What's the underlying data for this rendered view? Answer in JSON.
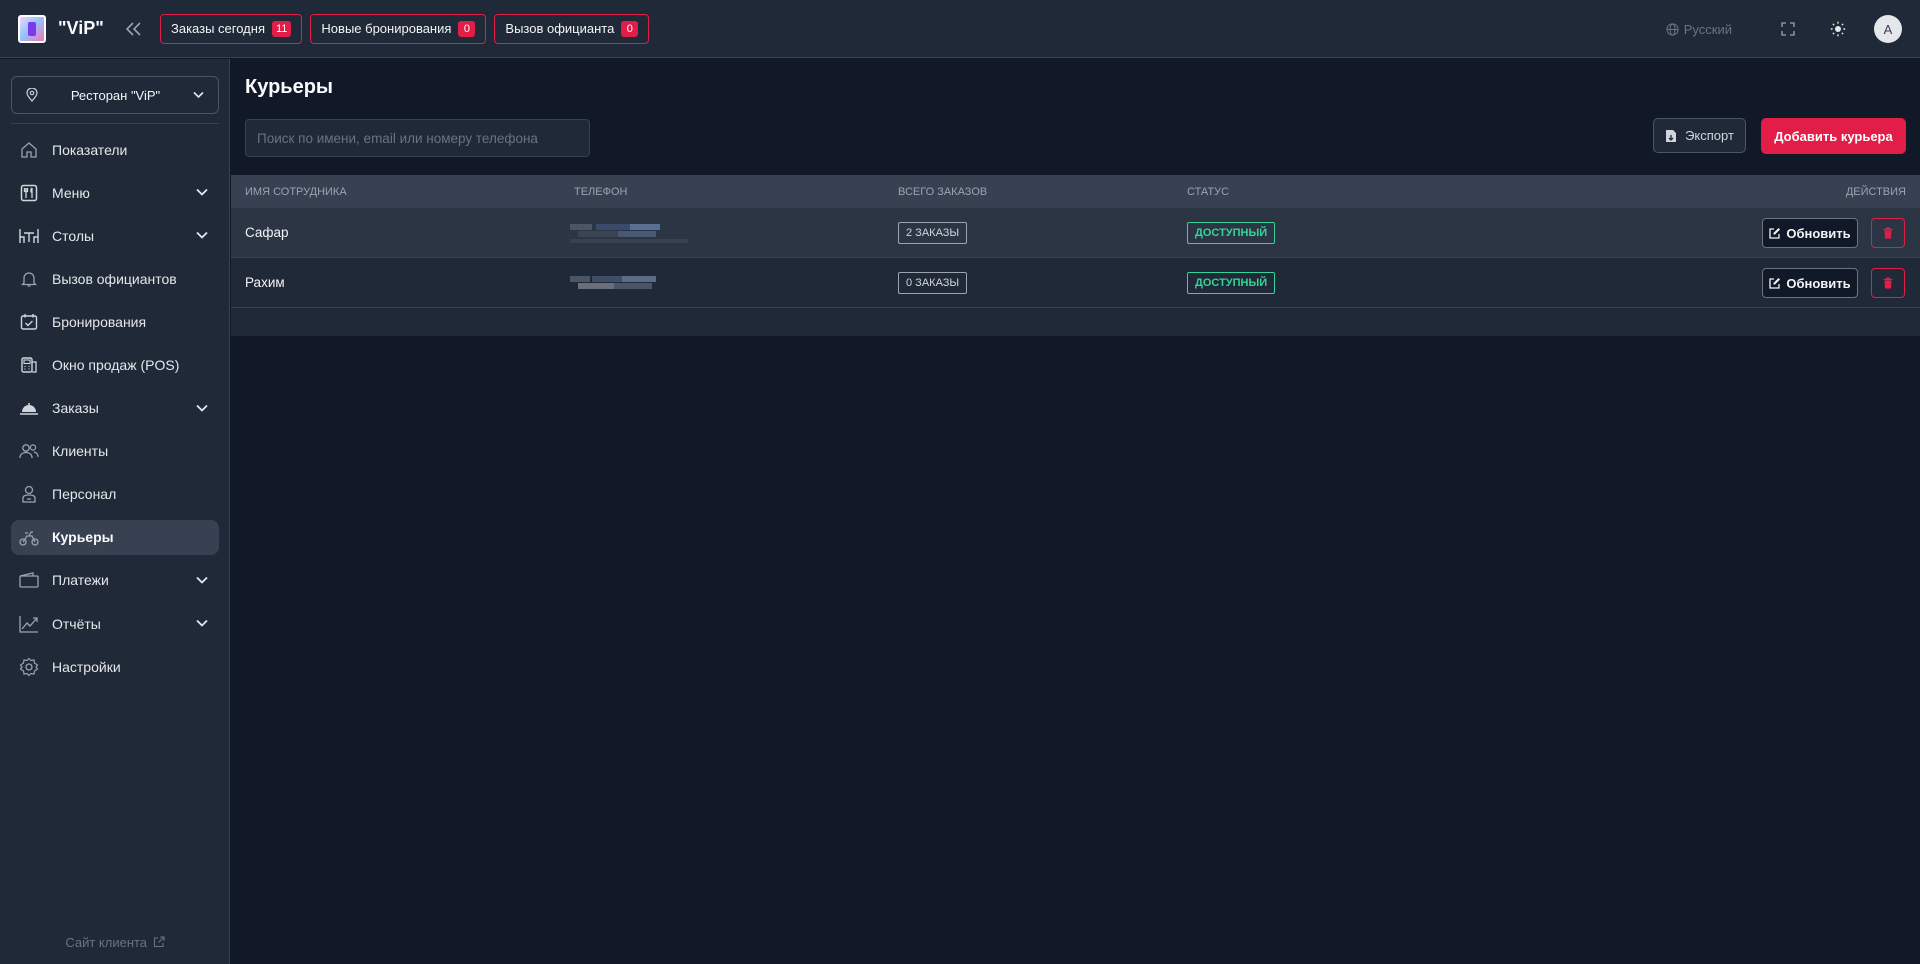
{
  "header": {
    "brand": "\"ViP\"",
    "pills": [
      {
        "label": "Заказы сегодня",
        "count": "11"
      },
      {
        "label": "Новые бронирования",
        "count": "0"
      },
      {
        "label": "Вызов официанта",
        "count": "0"
      }
    ],
    "language": "Русский",
    "avatar_initial": "A"
  },
  "sidebar": {
    "branch": "Ресторан \"ViP\"",
    "items": [
      {
        "label": "Показатели",
        "icon": "home-icon"
      },
      {
        "label": "Меню",
        "icon": "menu-utensils-icon",
        "expandable": true
      },
      {
        "label": "Столы",
        "icon": "table-icon",
        "expandable": true
      },
      {
        "label": "Вызов официантов",
        "icon": "bell-icon"
      },
      {
        "label": "Бронирования",
        "icon": "calendar-check-icon"
      },
      {
        "label": "Окно продаж (POS)",
        "icon": "pos-terminal-icon"
      },
      {
        "label": "Заказы",
        "icon": "cloche-icon",
        "expandable": true
      },
      {
        "label": "Клиенты",
        "icon": "users-icon"
      },
      {
        "label": "Персонал",
        "icon": "staff-icon"
      },
      {
        "label": "Курьеры",
        "icon": "courier-bike-icon",
        "active": true
      },
      {
        "label": "Платежи",
        "icon": "wallet-icon",
        "expandable": true
      },
      {
        "label": "Отчёты",
        "icon": "chart-line-icon",
        "expandable": true
      },
      {
        "label": "Настройки",
        "icon": "gear-icon"
      }
    ],
    "client_site": "Сайт клиента"
  },
  "main": {
    "title": "Курьеры",
    "search_placeholder": "Поиск по имени, email или номеру телефона",
    "export_label": "Экспорт",
    "add_label": "Добавить курьера",
    "table": {
      "columns": [
        "Имя сотрудника",
        "Телефон",
        "Всего заказов",
        "Статус",
        "Действия"
      ],
      "rows": [
        {
          "name": "Сафар",
          "orders": "2 Заказы",
          "status": "Доступный",
          "update": "Обновить"
        },
        {
          "name": "Рахим",
          "orders": "0 Заказы",
          "status": "Доступный",
          "update": "Обновить"
        }
      ]
    }
  },
  "colors": {
    "accent": "#e11d48",
    "status_available": "#34d399",
    "background": "#111827",
    "panel": "#1f2937"
  }
}
